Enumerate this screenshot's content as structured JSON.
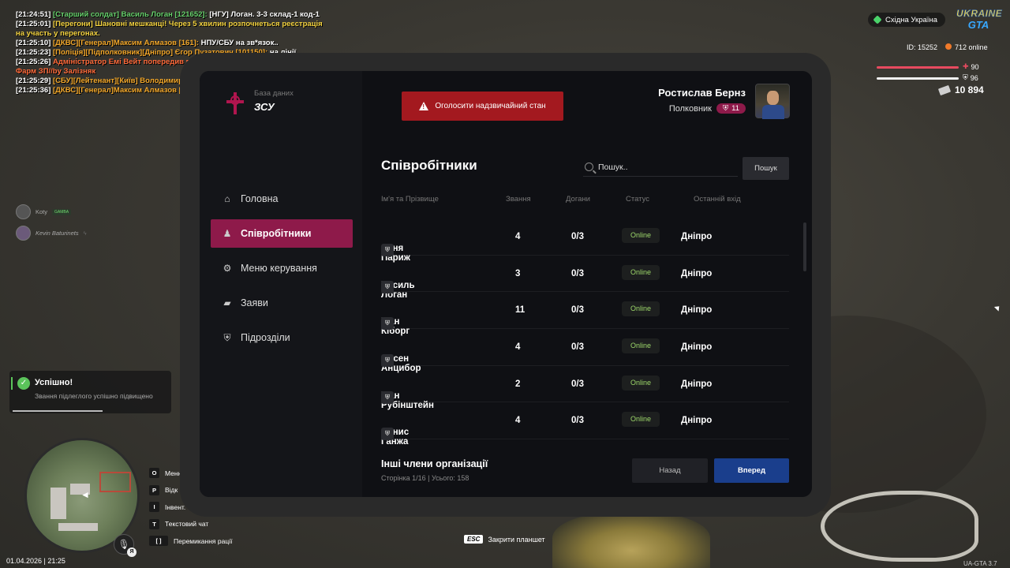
{
  "chat": [
    [
      {
        "c": "c-white",
        "t": "[21:24:51] "
      },
      {
        "c": "c-green",
        "t": "[Старший солдат]  Василь Логан [121652]: "
      },
      {
        "c": "c-white",
        "t": "[НГУ] Логан. 3-3 склад-1 код-1"
      }
    ],
    [
      {
        "c": "c-white",
        "t": "[21:25:01] "
      },
      {
        "c": "c-yellow",
        "t": "[Перегони] Шановні мешканці! Через 5 хвилин розпочнеться реєстрація на участь у перегонах."
      }
    ],
    [
      {
        "c": "c-white",
        "t": "[21:25:10] "
      },
      {
        "c": "c-orange",
        "t": "[ДКВС][Генерал]Максим Алмазов [161]: "
      },
      {
        "c": "c-white",
        "t": "НПУ/СБУ на зв*язок.."
      }
    ],
    [
      {
        "c": "c-white",
        "t": "[21:25:23] "
      },
      {
        "c": "c-orange",
        "t": "[Поліція][Підполковник][Дніпро] Єгор Пузатович [101150]: "
      },
      {
        "c": "c-white",
        "t": "на лінії"
      }
    ],
    [
      {
        "c": "c-white",
        "t": "[21:25:26] "
      },
      {
        "c": "c-red",
        "t": "Адміністратор Емі Вейт попередив гравця Тимур Фролов [1/3]. Причина: Фарм ЗП//by Залізняк"
      }
    ],
    [
      {
        "c": "c-white",
        "t": "[21:25:29] "
      },
      {
        "c": "c-orange",
        "t": "[СБУ][Лейтенант][Київ] Володимир Воловський [133852]: "
      },
      {
        "c": "c-white",
        "t": "Слухаю"
      }
    ],
    [
      {
        "c": "c-white",
        "t": "[21:25:36] "
      },
      {
        "c": "c-orange",
        "t": "[ДКВС][Генерал]Максим Алмазов [161]: "
      },
      {
        "c": "c-white",
        "t": "Відбій"
      }
    ]
  ],
  "hud": {
    "region": "Східна Україна",
    "logo_line1": "UKRAINE",
    "logo_line2": "GTA",
    "player_id": "ID: 15252",
    "online": "712 online",
    "health": "90",
    "armor": "96",
    "money": "10 894",
    "health_level": 0.9,
    "armor_level": 0.96
  },
  "voice": {
    "user1": "Koty",
    "user1_tag": "GAMBA",
    "user2": "Kevin Baturinets"
  },
  "toast": {
    "title": "Успішно!",
    "message": "Звання підлеглого успішно підвищено"
  },
  "keys": [
    {
      "key": "O",
      "label": "Меню"
    },
    {
      "key": "P",
      "label": "Відк"
    },
    {
      "key": "I",
      "label": "Інвент."
    },
    {
      "key": "T",
      "label": "Текстовий чат"
    },
    {
      "key": "[ ]",
      "label": "Перемикання рації"
    }
  ],
  "mic_badge": "Я",
  "datetime": "01.04.2026 | 21:25",
  "version": "UA-GTA 3.7",
  "esc": {
    "key": "ESC",
    "label": "Закрити планшет"
  },
  "tablet": {
    "db_label": "База даних",
    "org": "ЗСУ",
    "nav": [
      {
        "icon": "home-icon",
        "glyph": "⌂",
        "label": "Головна",
        "active": false
      },
      {
        "icon": "users-icon",
        "glyph": "♟",
        "label": "Співробітники",
        "active": true
      },
      {
        "icon": "gear-icon",
        "glyph": "⚙",
        "label": "Меню керування",
        "active": false
      },
      {
        "icon": "folder-icon",
        "glyph": "▰",
        "label": "Заяви",
        "active": false
      },
      {
        "icon": "shield-icon",
        "glyph": "⛨",
        "label": "Підрозділи",
        "active": false
      }
    ],
    "alert_button": "Оголосити надзвичайний стан",
    "profile": {
      "name": "Ростислав Бернз",
      "rank": "Полковник",
      "rank_level": "11"
    },
    "page_title": "Співробітники",
    "search_placeholder": "Пошук..",
    "search_button": "Пошук",
    "columns": {
      "name": "Ім'я та Прізвище",
      "rank": "Звання",
      "warnings": "Догани",
      "status": "Статус",
      "last": "Останній вхід"
    },
    "rows": [
      {
        "name": "Даня Париж",
        "rank": "4",
        "warnings": "0/3",
        "status": "Online",
        "last": "Дніпро"
      },
      {
        "name": "Василь Логан",
        "rank": "3",
        "warnings": "0/3",
        "status": "Online",
        "last": "Дніпро"
      },
      {
        "name": "Іван Кіборг",
        "rank": "11",
        "warnings": "0/3",
        "status": "Online",
        "last": "Дніпро"
      },
      {
        "name": "Арсен Анцибор",
        "rank": "4",
        "warnings": "0/3",
        "status": "Online",
        "last": "Дніпро"
      },
      {
        "name": "Іван Рубінштейн",
        "rank": "2",
        "warnings": "0/3",
        "status": "Online",
        "last": "Дніпро"
      },
      {
        "name": "Денис Ганжа",
        "rank": "4",
        "warnings": "0/3",
        "status": "Online",
        "last": "Дніпро"
      }
    ],
    "footer_title": "Інші члени організації",
    "footer_info": "Сторінка 1/16 | Усього: 158",
    "back_button": "Назад",
    "next_button": "Вперед"
  }
}
